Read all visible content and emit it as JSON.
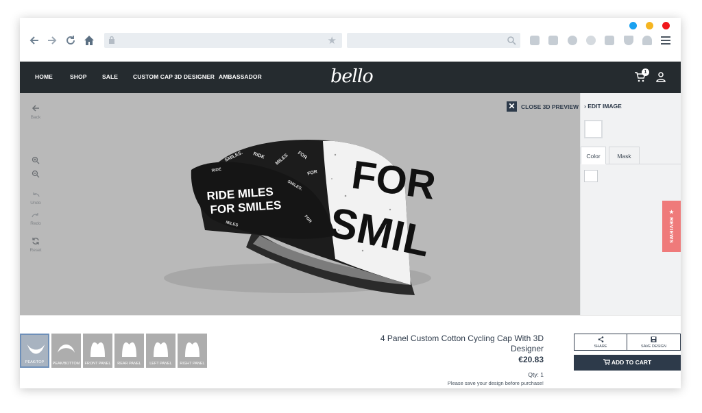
{
  "browser": {
    "window_dots": [
      "#1aa1f0",
      "#f5b521",
      "#f0171b"
    ],
    "nav_icons": [
      "back-arrow-icon",
      "forward-arrow-icon",
      "reload-icon",
      "home-icon"
    ],
    "url_value": "",
    "search_value": "",
    "extension_icons": [
      "cloud-icon",
      "camera-icon",
      "alert-icon",
      "wifi-icon",
      "briefcase-icon",
      "shield-icon",
      "heart-icon",
      "menu-icon"
    ]
  },
  "site_nav": {
    "links": [
      "HOME",
      "SHOP",
      "SALE",
      "CUSTOM CAP 3D DESIGNER",
      "AMBASSADOR"
    ],
    "logo": "bello",
    "cart_count": "1"
  },
  "viewer": {
    "tools": [
      {
        "icon": "back-arrow-icon",
        "label": "Back"
      },
      {
        "icon": "zoom-in-icon",
        "label": ""
      },
      {
        "icon": "zoom-out-icon",
        "label": ""
      },
      {
        "icon": "undo-icon",
        "label": "Undo"
      },
      {
        "icon": "redo-icon",
        "label": "Redo"
      },
      {
        "icon": "reset-icon",
        "label": "Reset"
      }
    ],
    "close_preview_label": "CLOSE 3D PREVIEW",
    "cap_print": {
      "brim_line1": "RIDE MILES",
      "brim_line2": "FOR SMILES",
      "side_line1": "FOR",
      "side_line2": "SMIL"
    }
  },
  "panel": {
    "edit_image_label": "EDIT IMAGE",
    "tabs": [
      "Color",
      "Mask"
    ],
    "active_tab": "Color",
    "reviews_label": "★ REVIEWS"
  },
  "parts": [
    {
      "label": "PEAK/TOP",
      "selected": true
    },
    {
      "label": "PEAK/BOTTOM",
      "selected": false
    },
    {
      "label": "FRONT PANEL",
      "selected": false
    },
    {
      "label": "REAR PANEL",
      "selected": false
    },
    {
      "label": "LEFT PANEL",
      "selected": false
    },
    {
      "label": "RIGHT PANEL",
      "selected": false
    }
  ],
  "product": {
    "title": "4 Panel Custom Cotton Cycling Cap With 3D Designer",
    "price": "€20.83",
    "qty": "Qty: 1",
    "note": "Please save your design before purchase!"
  },
  "actions": {
    "share_label": "SHARE",
    "save_label": "SAVE DESIGN",
    "add_to_cart_label": "ADD TO CART"
  },
  "colors": {
    "nav_bg": "#252b2f",
    "viewer_bg": "#b9b9b9",
    "primary": "#2d3a4a",
    "reviews": "#ef7a7a"
  }
}
